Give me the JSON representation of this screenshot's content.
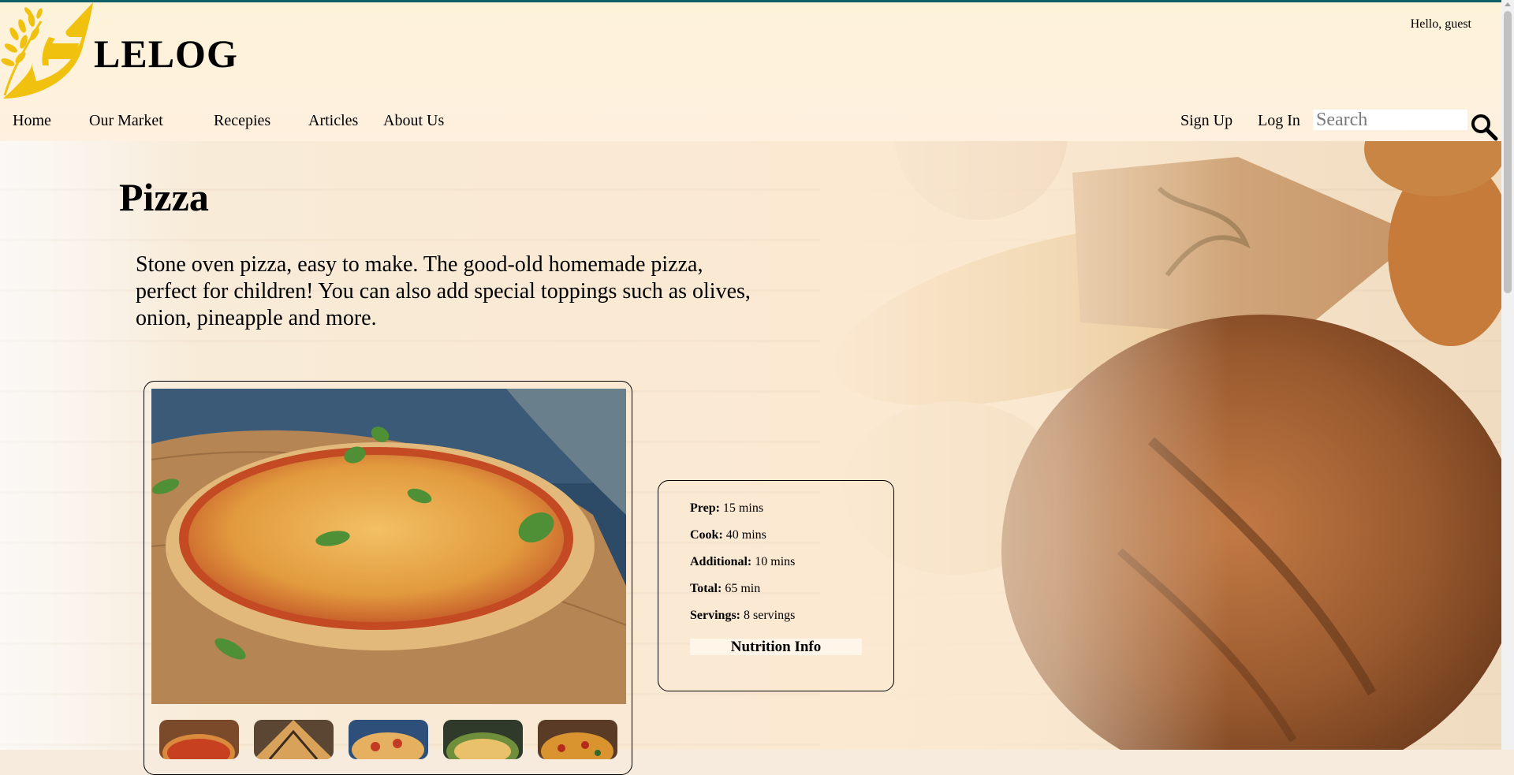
{
  "header": {
    "brand": "LELOG",
    "greeting": "Hello, guest",
    "nav": [
      "Home",
      "Our Market",
      "Recepies",
      "Articles",
      "About Us"
    ],
    "signup": "Sign Up",
    "login": "Log In",
    "search_placeholder": "Search"
  },
  "recipe": {
    "title": "Pizza",
    "description": "Stone oven pizza, easy to make. The good-old homemade pizza, perfect for children! You can also add special toppings such as olives, onion, pineapple and more.",
    "info": [
      {
        "label": "Prep:",
        "value": " 15 mins"
      },
      {
        "label": "Cook:",
        "value": " 40 mins"
      },
      {
        "label": "Additional:",
        "value": " 10 mins"
      },
      {
        "label": "Total:",
        "value": " 65 min"
      },
      {
        "label": "Servings:",
        "value": " 8 servings"
      }
    ],
    "nutrition_button": "Nutrition Info"
  },
  "colors": {
    "accent_line": "#0e6166",
    "logo_gold": "#f1c10f"
  }
}
